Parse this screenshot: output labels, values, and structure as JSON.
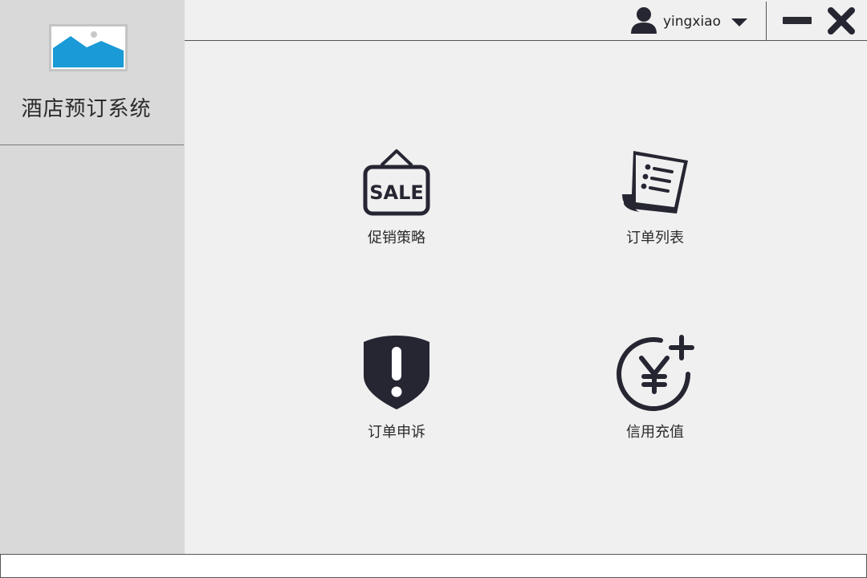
{
  "sidebar": {
    "logo_icon": "image-placeholder-icon",
    "title": "酒店预订系统"
  },
  "topbar": {
    "username": "yingxiao",
    "user_icon": "user-icon",
    "menu_icon": "caret-down-icon",
    "minimize_icon": "minimize-icon",
    "close_icon": "close-icon"
  },
  "tiles": [
    {
      "label": "促销策略",
      "icon": "sale-sign-icon"
    },
    {
      "label": "订单列表",
      "icon": "order-list-icon"
    },
    {
      "label": "订单申诉",
      "icon": "alert-shield-icon"
    },
    {
      "label": "信用充值",
      "icon": "yuan-recharge-icon"
    }
  ],
  "colors": {
    "sidebar_bg": "#d9d9d9",
    "page_bg": "#f0f0f0",
    "icon_color": "#262633",
    "logo_blue": "#1a9ad6"
  }
}
